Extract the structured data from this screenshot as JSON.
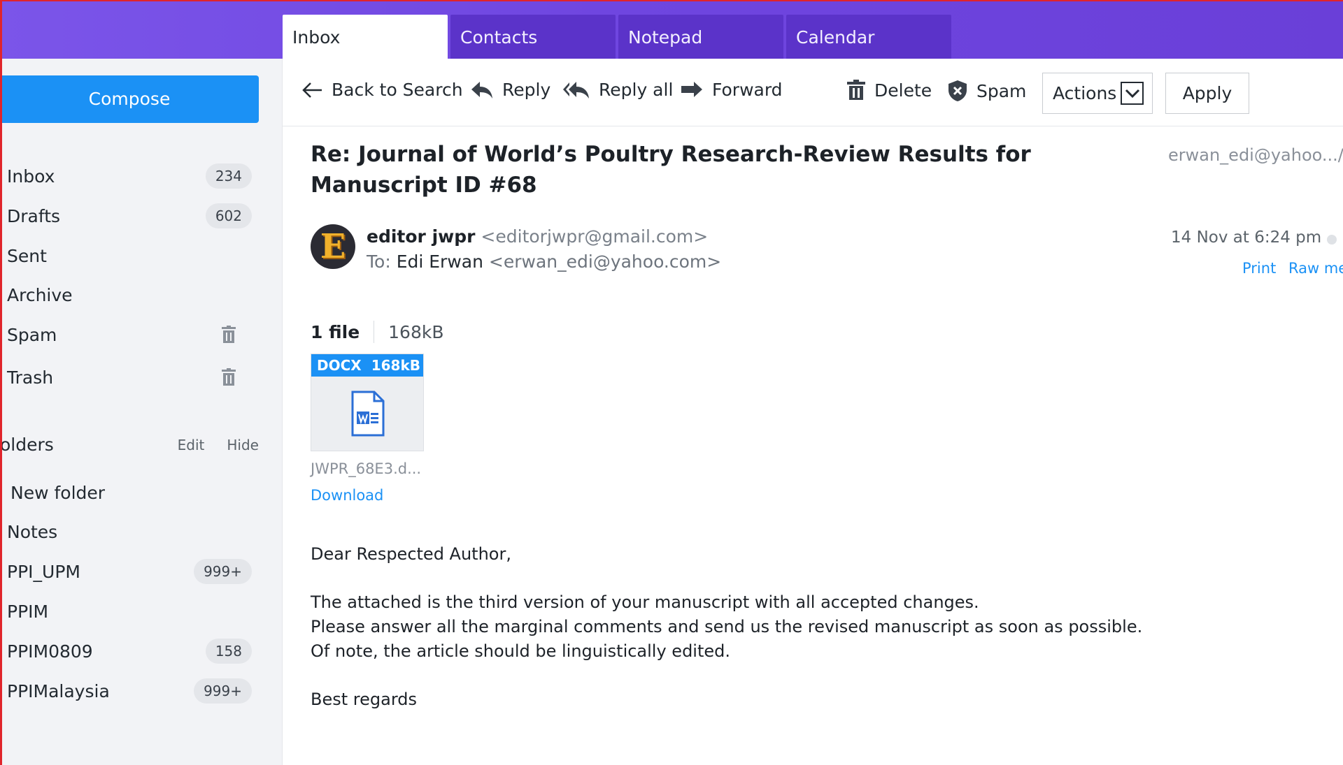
{
  "tabs": [
    {
      "label": "Inbox",
      "active": true
    },
    {
      "label": "Contacts",
      "active": false
    },
    {
      "label": "Notepad",
      "active": false
    },
    {
      "label": "Calendar",
      "active": false
    }
  ],
  "sidebar": {
    "compose_label": "Compose",
    "folders": [
      {
        "label": "Inbox",
        "count": "234"
      },
      {
        "label": "Drafts",
        "count": "602"
      },
      {
        "label": "Sent",
        "count": ""
      },
      {
        "label": "Archive",
        "count": ""
      },
      {
        "label": "Spam",
        "count": "",
        "icon": "trash-icon"
      },
      {
        "label": "Trash",
        "count": "",
        "icon": "trash-icon"
      }
    ],
    "folders_header": {
      "title": "olders",
      "edit": "Edit",
      "hide": "Hide"
    },
    "custom_folders": [
      {
        "label": "New folder",
        "count": ""
      },
      {
        "label": "Notes",
        "count": ""
      },
      {
        "label": "PPI_UPM",
        "count": "999+"
      },
      {
        "label": "PPIM",
        "count": ""
      },
      {
        "label": "PPIM0809",
        "count": "158"
      },
      {
        "label": "PPIMalaysia",
        "count": "999+"
      }
    ]
  },
  "toolbar": {
    "back": "Back to Search",
    "reply": "Reply",
    "reply_all": "Reply all",
    "forward": "Forward",
    "delete": "Delete",
    "spam": "Spam",
    "actions": "Actions",
    "apply": "Apply"
  },
  "message": {
    "subject": "Re: Journal of World’s Poultry Research-Review Results for Manuscript ID #68",
    "recipient_short": "erwan_edi@yahoo.../In",
    "avatar_letter": "E",
    "sender_name": "editor jwpr",
    "sender_email": "<editorjwpr@gmail.com>",
    "to_prefix": "To:",
    "to_name": "Edi Erwan",
    "to_email": "<erwan_edi@yahoo.com>",
    "date": "14 Nov at 6:24 pm",
    "print": "Print",
    "raw": "Raw me",
    "file_count": "1 file",
    "file_size": "168kB",
    "attachment": {
      "type": "DOCX",
      "size": "168kB",
      "name": "JWPR_68E3.d...",
      "download": "Download"
    },
    "body": {
      "greeting": "Dear Respected Author,",
      "line1": "The attached is the third version of your manuscript with all accepted changes.",
      "line2": "Please answer all the marginal comments and send us the revised manuscript as soon as possible.",
      "line3": "Of note, the article should be linguistically edited.",
      "closing": "Best regards"
    }
  },
  "colors": {
    "accent": "#1b91f5",
    "topbar": "#6f46e0",
    "tab_inactive": "#5b33c9"
  }
}
